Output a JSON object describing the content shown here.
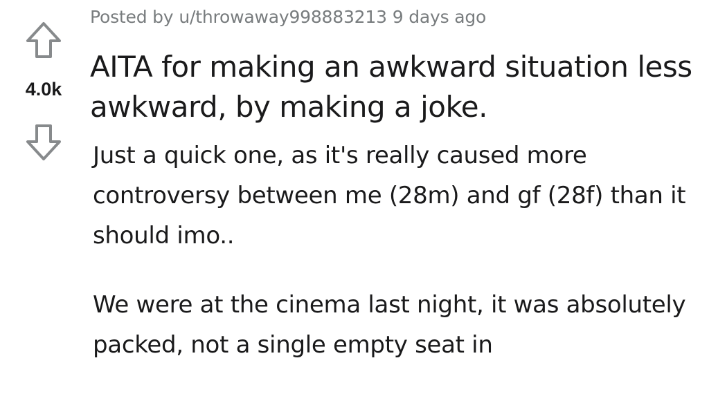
{
  "post": {
    "author_prefix": "Posted by",
    "author": "u/throwaway998883213",
    "time": "9 days ago",
    "score": "4.0k",
    "title": "AITA for making an awkward situation less awkward, by making a joke.",
    "paragraphs": [
      "Just a quick one, as it's really caused more controversy between me (28m) and gf (28f) than it should imo..",
      "We were at the cinema last night, it was absolutely packed, not a single empty seat in"
    ]
  },
  "icons": {
    "upvote": "upvote-arrow-icon",
    "downvote": "downvote-arrow-icon"
  },
  "colors": {
    "text": "#1a1a1b",
    "meta": "#787c7e",
    "icon": "#878a8c"
  }
}
